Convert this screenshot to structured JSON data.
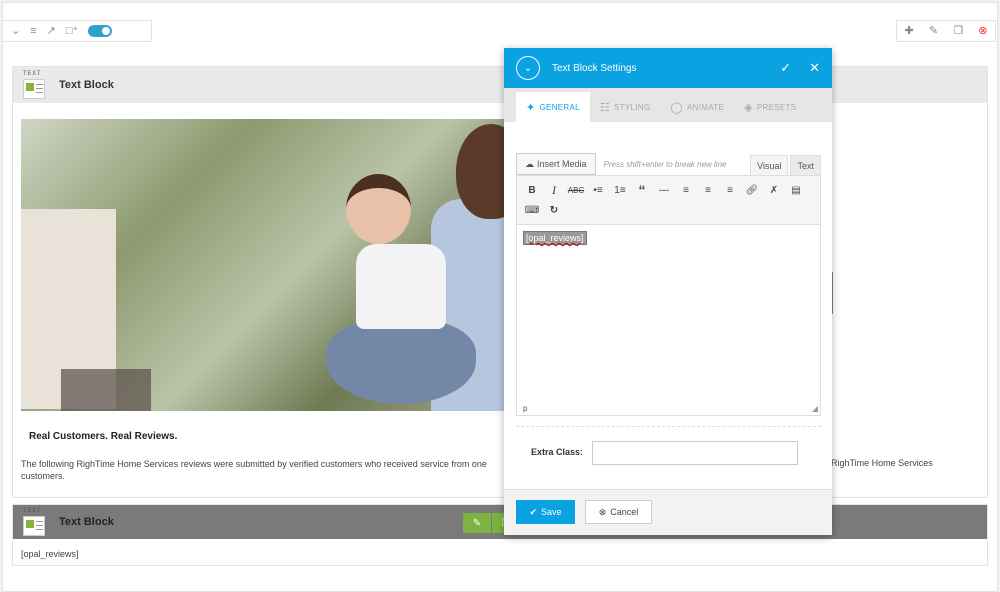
{
  "toolbar_left": {
    "icons": [
      "chevron-down-icon",
      "list-icon",
      "export-icon",
      "add-page-icon"
    ]
  },
  "toolbar_right": {
    "icons": [
      "move-icon",
      "edit-icon",
      "copy-icon",
      "delete-icon"
    ]
  },
  "text_block_thumb_label": "TEXT",
  "block1": {
    "title": "Text Block",
    "caption_title": "Real Customers. Real Reviews.",
    "caption_text": "The following RighTime Home Services reviews were submitted by verified customers who received service from one",
    "caption_text_end": "customers.",
    "caption_right": "RighTime Home Services"
  },
  "block2": {
    "title": "Text Block",
    "content": "[opal_reviews]"
  },
  "modal": {
    "title": "Text Block Settings",
    "tabs": [
      {
        "label": "GENERAL",
        "icon": "wand-icon"
      },
      {
        "label": "STYLING",
        "icon": "sliders-icon"
      },
      {
        "label": "ANIMATE",
        "icon": "bulb-icon"
      },
      {
        "label": "PRESETS",
        "icon": "layers-icon"
      }
    ],
    "insert_media_label": "Insert Media",
    "hint": "Press shift+enter to break new line",
    "tab_visual": "Visual",
    "tab_text": "Text",
    "content": "[opal_reviews]",
    "status_path": "p",
    "extra_class_label": "Extra Class:",
    "extra_class_value": "",
    "save_label": "Save",
    "cancel_label": "Cancel"
  },
  "colors": {
    "accent": "#0aa2e0",
    "green": "#7cb342",
    "delete": "#e33333"
  }
}
